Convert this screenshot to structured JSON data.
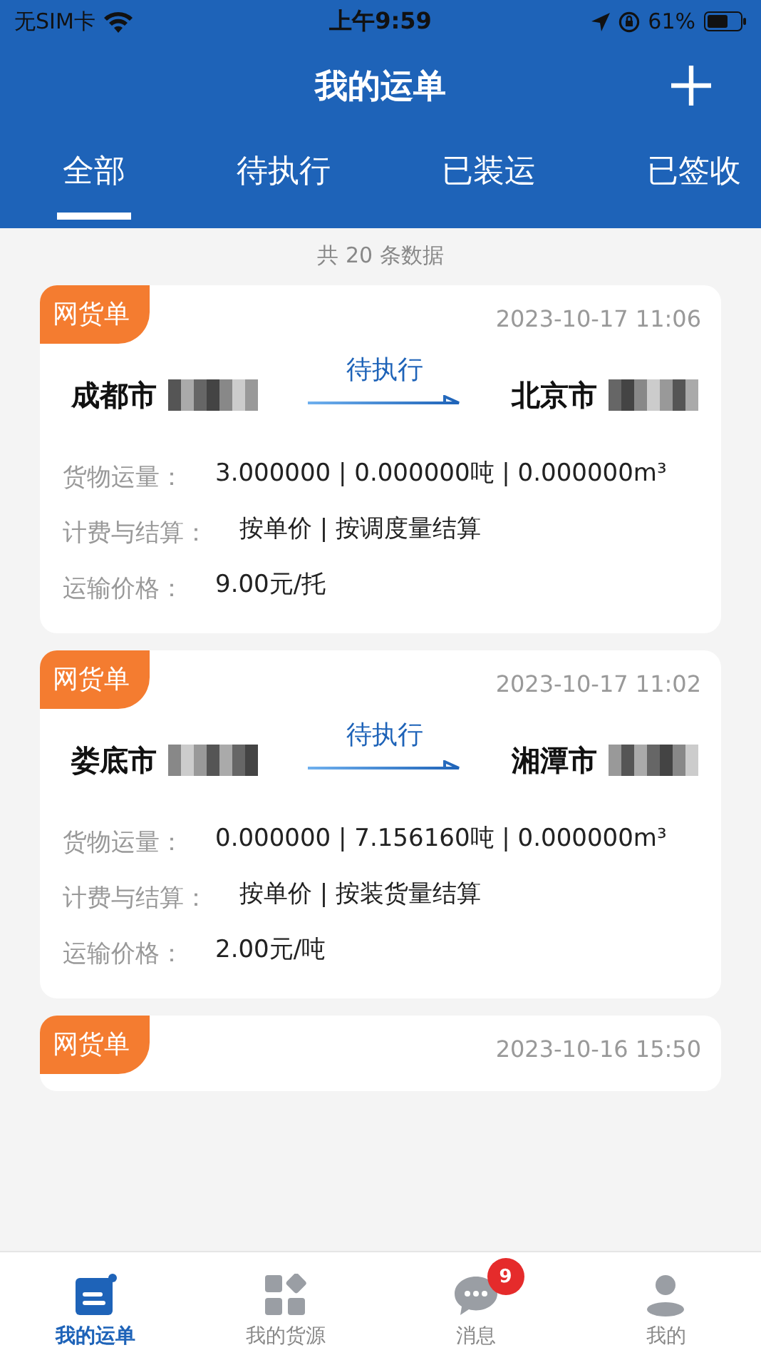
{
  "status_bar": {
    "carrier": "无SIM卡",
    "time": "上午9:59",
    "battery": "61%"
  },
  "header": {
    "title": "我的运单"
  },
  "tabs": [
    {
      "label": "全部",
      "selected": true
    },
    {
      "label": "待执行",
      "selected": false
    },
    {
      "label": "已装运",
      "selected": false
    },
    {
      "label": "已签收",
      "selected": false
    }
  ],
  "count": "共 20 条数据",
  "orders": [
    {
      "tag": "网货单",
      "time": "2023-10-17 11:06",
      "status": "待执行",
      "from_city": "成都市",
      "to_city": "北京市",
      "rows": [
        {
          "label": "货物运量：",
          "value": "3.000000 | 0.000000吨 | 0.000000m³"
        },
        {
          "label": "计费与结算：",
          "value": "按单价 | 按调度量结算"
        },
        {
          "label": "运输价格：",
          "value": "9.00元/托"
        }
      ]
    },
    {
      "tag": "网货单",
      "time": "2023-10-17 11:02",
      "status": "待执行",
      "from_city": "娄底市",
      "to_city": "湘潭市",
      "rows": [
        {
          "label": "货物运量：",
          "value": "0.000000 | 7.156160吨 | 0.000000m³"
        },
        {
          "label": "计费与结算：",
          "value": "按单价 | 按装货量结算"
        },
        {
          "label": "运输价格：",
          "value": "2.00元/吨"
        }
      ]
    },
    {
      "tag": "网货单",
      "time": "2023-10-16 15:50"
    }
  ],
  "tab_bar": [
    {
      "kind": "waybill",
      "label": "我的运单",
      "selected": true
    },
    {
      "kind": "goods",
      "label": "我的货源",
      "selected": false
    },
    {
      "kind": "messages",
      "label": "消息",
      "selected": false,
      "badge": "9"
    },
    {
      "kind": "profile",
      "label": "我的",
      "selected": false
    }
  ]
}
